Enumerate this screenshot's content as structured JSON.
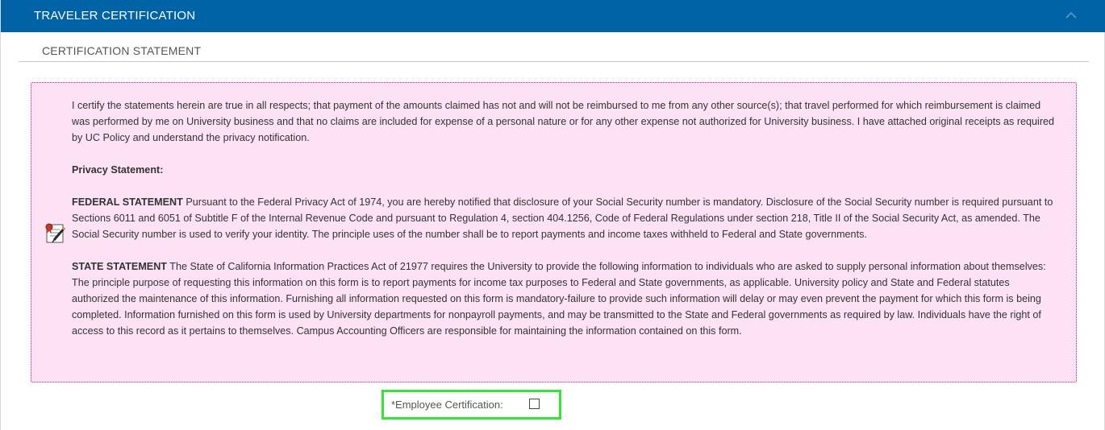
{
  "panel": {
    "title": "TRAVELER CERTIFICATION",
    "collapse_icon": "chevron-up-icon",
    "header_color": "#0063a6"
  },
  "section": {
    "title": "CERTIFICATION STATEMENT"
  },
  "statement": {
    "background_color": "#fde1f5",
    "border_color": "#c0198a",
    "icon": "certificate-pen-icon",
    "intro": "I certify the statements herein are true in all respects; that payment of the amounts claimed has not and will not be reimbursed to me from any other source(s); that travel performed for which reimbursement is claimed was performed by me on University business and that no claims are included for expense of a personal nature or for any other expense not authorized for University business. I have attached original receipts as required by UC Policy and understand the privacy notification.",
    "privacy_heading": "Privacy Statement:",
    "federal_heading": "FEDERAL STATEMENT",
    "federal_text": " Pursuant to the Federal Privacy Act of 1974, you are hereby notified that disclosure of your Social Security number is mandatory. Disclosure of the Social Security number is required pursuant to Sections 6011 and 6051 of Subtitle F of the Internal Revenue Code and pursuant to Regulation 4, section 404.1256, Code of Federal Regulations under section 218, Title II of the Social Security Act, as amended. The Social Security number is used to verify your identity. The principle uses of the number shall be to report payments and income taxes withheld to Federal and State governments.",
    "state_heading": "STATE STATEMENT",
    "state_text": " The State of California Information Practices Act of 21977 requires the University to provide the following information to individuals who are asked to supply personal information about themselves: The principle purpose of requesting this information on this form is to report payments for income tax purposes to Federal and State governments, as applicable. University policy and State and Federal statutes authorized the maintenance of this information. Furnishing all information requested on this form is mandatory-failure to provide such information will delay or may even prevent the payment for which this form is being completed. Information furnished on this form is used by University departments for nonpayroll payments, and may be transmitted to the State and Federal governments as required by law. Individuals have the right of access to this record as it pertains to themselves. Campus Accounting Officers are responsible for maintaining the information contained on this form."
  },
  "certification": {
    "label": "*Employee Certification:",
    "checked": false,
    "highlight_color": "#33e633"
  }
}
